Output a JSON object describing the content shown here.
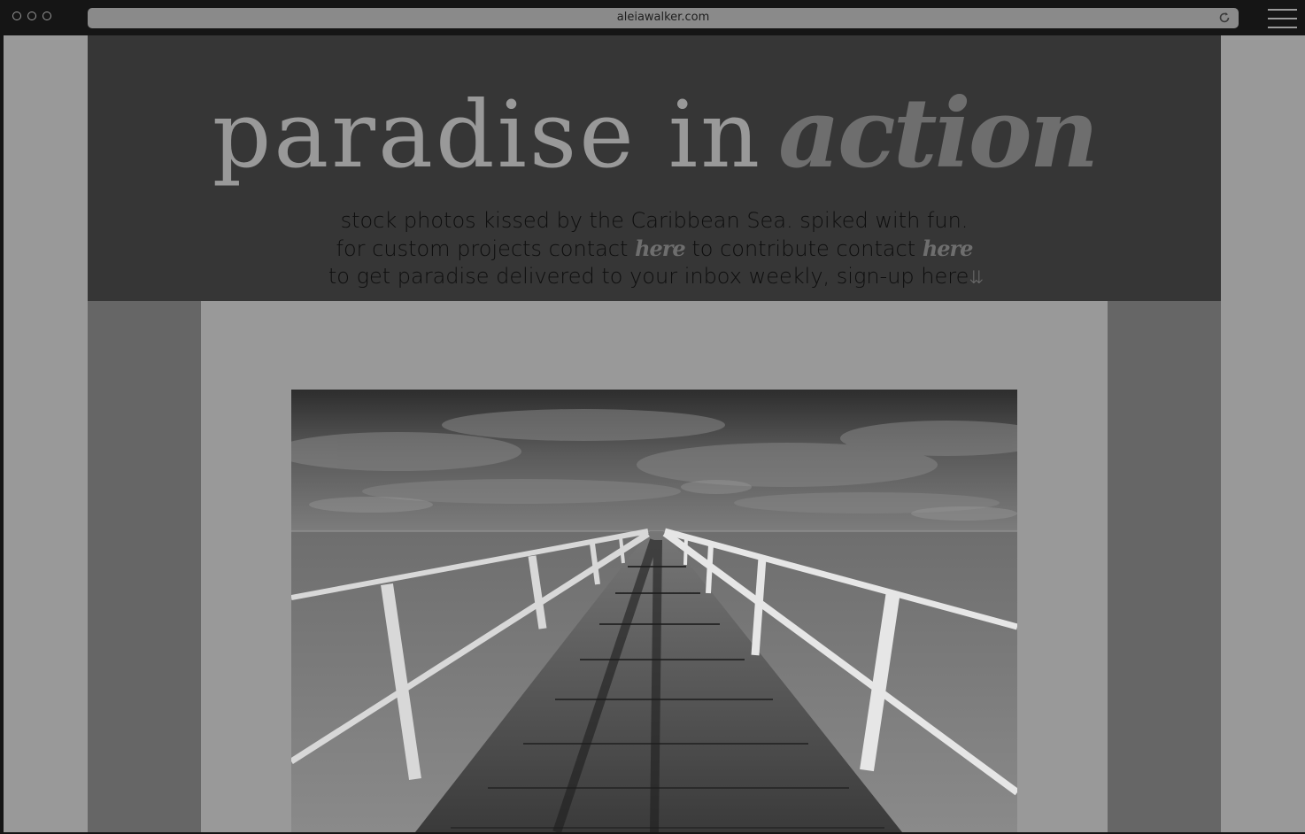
{
  "browser": {
    "url": "aleiawalker.com"
  },
  "hero": {
    "title_part1": "paradise in",
    "title_part2": "action",
    "line1": "stock photos kissed by the Caribbean Sea. spiked with fun.",
    "line2_a": "for custom projects contact",
    "line2_link1": "here",
    "line2_b": "to contribute contact",
    "line2_link2": "here",
    "line3": "to get paradise delivered to your inbox weekly, sign-up here",
    "line3_arrows": "⇊"
  },
  "colors": {
    "hero_bg": "#363636",
    "page_bg": "#999999",
    "side_columns": "#666666",
    "accent_text": "#6e6e6e"
  }
}
